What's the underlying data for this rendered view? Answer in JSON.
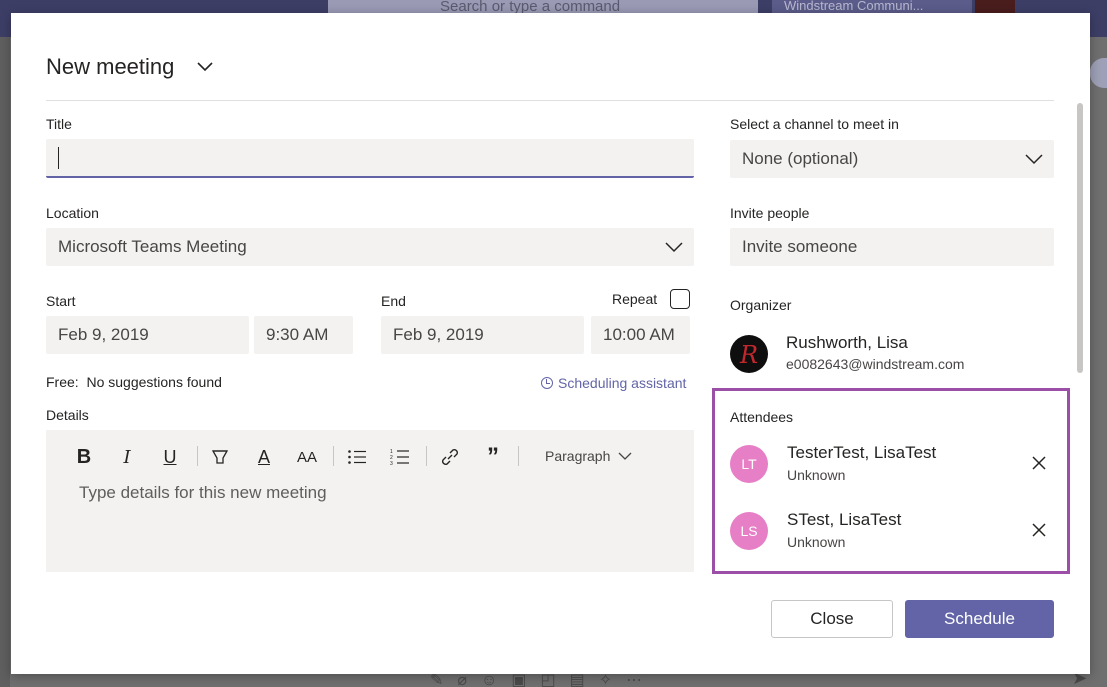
{
  "background": {
    "search_placeholder": "Search or type a command",
    "org_name": "Windstream Communi...",
    "bottom_icons": [
      "format-icon",
      "attach-icon",
      "emoji-icon",
      "gif-icon",
      "sticker-icon",
      "meet-icon",
      "praise-icon",
      "more-icon"
    ]
  },
  "dialog": {
    "title": "New meeting",
    "title_field": {
      "label": "Title",
      "value": ""
    },
    "location": {
      "label": "Location",
      "value": "Microsoft Teams Meeting"
    },
    "start": {
      "label": "Start",
      "date": "Feb 9, 2019",
      "time": "9:30 AM"
    },
    "end": {
      "label": "End",
      "date": "Feb 9, 2019",
      "time": "10:00 AM"
    },
    "repeat": {
      "label": "Repeat",
      "checked": false
    },
    "free_prefix": "Free:",
    "free_text": "No suggestions found",
    "scheduling_assistant": "Scheduling assistant",
    "details": {
      "label": "Details",
      "placeholder": "Type details for this new meeting",
      "paragraph_label": "Paragraph"
    },
    "channel": {
      "label": "Select a channel to meet in",
      "value": "None (optional)"
    },
    "invite": {
      "label": "Invite people",
      "placeholder": "Invite someone"
    },
    "organizer": {
      "label": "Organizer",
      "name": "Rushworth, Lisa",
      "email": "e0082643@windstream.com"
    },
    "attendees": {
      "label": "Attendees",
      "list": [
        {
          "initials": "LT",
          "name": "TesterTest, LisaTest",
          "status": "Unknown"
        },
        {
          "initials": "LS",
          "name": "STest, LisaTest",
          "status": "Unknown"
        }
      ]
    },
    "buttons": {
      "close": "Close",
      "schedule": "Schedule"
    }
  },
  "colors": {
    "accent": "#6264a7",
    "highlight_border": "#9b4fa6",
    "attendee_avatar": "#e67fc5"
  }
}
